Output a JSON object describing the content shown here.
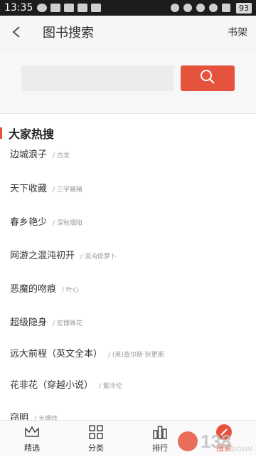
{
  "status_bar": {
    "time": "13:35",
    "battery": "93"
  },
  "header": {
    "back_icon": "chevron-left-icon",
    "title": "图书搜索",
    "shelf_label": "书架"
  },
  "search": {
    "value": "",
    "placeholder": "",
    "button_icon": "search-icon"
  },
  "hot": {
    "title": "大家热搜",
    "items": [
      {
        "name": "边城浪子",
        "author": "/ 古龙"
      },
      {
        "name": "天下收藏",
        "author": "/ 三字猪猪"
      },
      {
        "name": "春乡艳少",
        "author": "/ 深秋烟阳"
      },
      {
        "name": "网游之混沌初开",
        "author": "/ 混沌修梦卜"
      },
      {
        "name": "恶魔的吻痕",
        "author": "/ 叶心"
      },
      {
        "name": "超级隐身",
        "author": "/ 宏博殊花"
      },
      {
        "name": "远大前程（英文全本）",
        "author": "/ (英)查尔斯·狄更斯"
      },
      {
        "name": "花非花（穿越小说）",
        "author": "/ 紫冷伦"
      },
      {
        "name": "窃明",
        "author": "/ 大爆炸"
      }
    ]
  },
  "tabbar": {
    "tabs": [
      {
        "label": "精选",
        "icon": "crown-icon"
      },
      {
        "label": "分类",
        "icon": "grid-icon"
      },
      {
        "label": "排行",
        "icon": "ranking-icon"
      },
      {
        "label": "搜索",
        "icon": "search-icon"
      }
    ]
  },
  "watermark": {
    "text": "138",
    "subtext": "DOWN"
  },
  "colors": {
    "accent": "#e5533d",
    "status_bar": "#1c1c1c"
  }
}
